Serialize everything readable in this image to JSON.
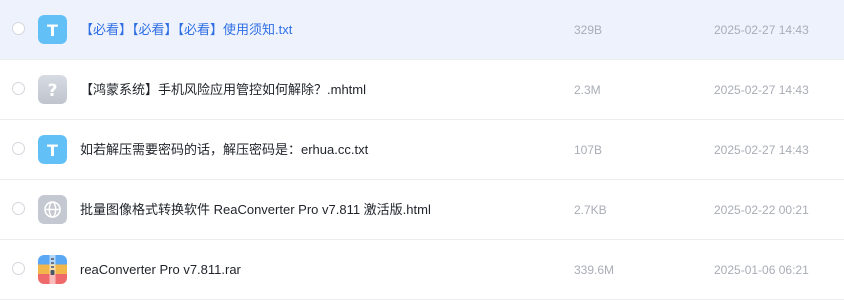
{
  "files": [
    {
      "icon": "text-file-icon",
      "name": "【必看】【必看】【必看】使用须知.txt",
      "size": "329B",
      "date": "2025-02-27 14:43",
      "highlighted": true
    },
    {
      "icon": "unknown-file-icon",
      "name": "【鸿蒙系统】手机风险应用管控如何解除？.mhtml",
      "size": "2.3M",
      "date": "2025-02-27 14:43",
      "highlighted": false
    },
    {
      "icon": "text-file-icon",
      "name": "如若解压需要密码的话，解压密码是：erhua.cc.txt",
      "size": "107B",
      "date": "2025-02-27 14:43",
      "highlighted": false
    },
    {
      "icon": "web-file-icon",
      "name": "批量图像格式转换软件 ReaConverter Pro v7.811 激活版.html",
      "size": "2.7KB",
      "date": "2025-02-22 00:21",
      "highlighted": false
    },
    {
      "icon": "archive-file-icon",
      "name": "reaConverter Pro v7.811.rar",
      "size": "339.6M",
      "date": "2025-01-06 06:21",
      "highlighted": false
    }
  ],
  "icon_glyphs": {
    "text": "T",
    "unknown": "?"
  },
  "colors": {
    "highlight_row": "#eef2fd",
    "highlight_text": "#2f6fe4",
    "text_icon": "#62c0f7",
    "unknown_icon": "#c9cdd6",
    "web_icon": "#c3c8d1",
    "meta_text": "#a9adb5"
  }
}
